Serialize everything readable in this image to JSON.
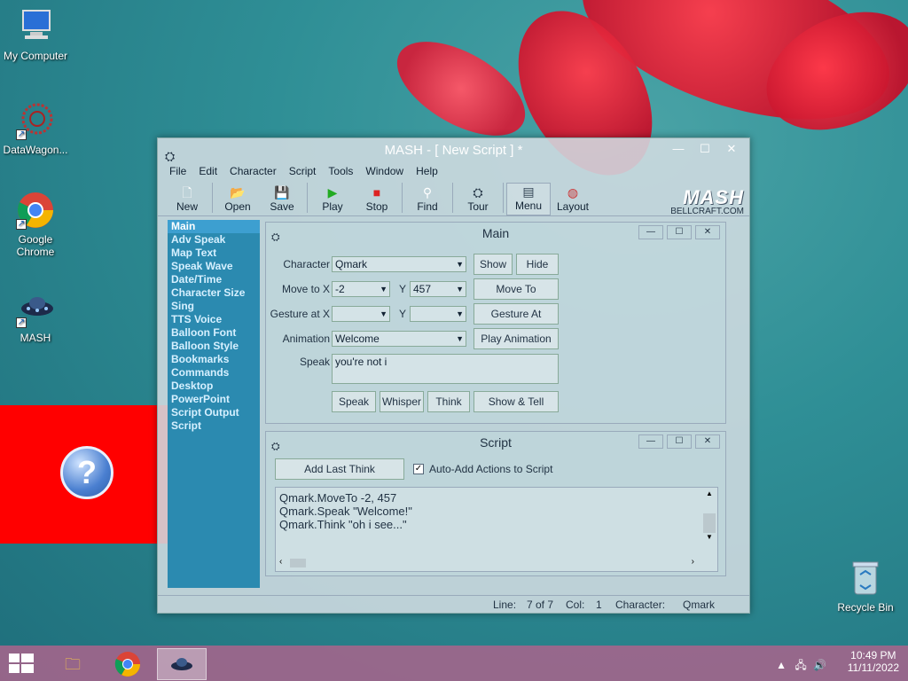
{
  "desktop": {
    "icons": [
      {
        "label": "My Computer",
        "icon": "computer-icon"
      },
      {
        "label": "DataWagon...",
        "icon": "datawagon-icon"
      },
      {
        "label": "Google Chrome",
        "icon": "chrome-icon"
      },
      {
        "label": "MASH",
        "icon": "mash-icon"
      }
    ],
    "recycle_bin": "Recycle Bin",
    "help_glyph": "?"
  },
  "window": {
    "title": "MASH - [ New Script ] *",
    "menu": [
      "File",
      "Edit",
      "Character",
      "Script",
      "Tools",
      "Window",
      "Help"
    ],
    "toolbar": [
      {
        "label": "New",
        "icon": "new-file-icon"
      },
      {
        "label": "Open",
        "icon": "open-folder-icon"
      },
      {
        "label": "Save",
        "icon": "save-disk-icon"
      },
      {
        "label": "Play",
        "icon": "play-icon"
      },
      {
        "label": "Stop",
        "icon": "stop-icon"
      },
      {
        "label": "Find",
        "icon": "find-icon"
      },
      {
        "label": "Tour",
        "icon": "tour-icon"
      },
      {
        "label": "Menu",
        "icon": "menu-icon"
      },
      {
        "label": "Layout",
        "icon": "layout-icon"
      }
    ],
    "brand": {
      "logo": "MASH",
      "sub": "BELLCRAFT.COM"
    }
  },
  "nav": {
    "items": [
      "Main",
      "Adv Speak",
      "Map Text",
      "Speak Wave",
      "Date/Time",
      "Character Size",
      "Sing",
      "TTS Voice",
      "Balloon Font",
      "Balloon Style",
      "Bookmarks",
      "Commands",
      "Desktop",
      "PowerPoint",
      "Script Output",
      "Script"
    ],
    "selected": "Main"
  },
  "main_panel": {
    "title": "Main",
    "character_label": "Character",
    "character_value": "Qmark",
    "show_label": "Show",
    "hide_label": "Hide",
    "move_to_label": "Move to X",
    "move_x": "-2",
    "y_label": "Y",
    "move_y": "457",
    "move_to_btn": "Move To",
    "gesture_label": "Gesture at X",
    "gesture_x": "",
    "gesture_y_label": "Y",
    "gesture_y": "",
    "gesture_btn": "Gesture At",
    "animation_label": "Animation",
    "animation_value": "Welcome",
    "play_animation_btn": "Play Animation",
    "speak_label": "Speak",
    "speak_value": "you're not i",
    "speak_btn": "Speak",
    "whisper_btn": "Whisper",
    "think_btn": "Think",
    "show_tell_btn": "Show & Tell"
  },
  "script_panel": {
    "title": "Script",
    "add_last_think_btn": "Add Last Think",
    "auto_add_label": "Auto-Add Actions to Script",
    "lines": [
      "Qmark.MoveTo -2, 457",
      "Qmark.Speak \"Welcome!\"",
      "Qmark.Think \"oh i see...\""
    ]
  },
  "status": {
    "line_label": "Line:",
    "line_value": "7 of 7",
    "col_label": "Col:",
    "col_value": "1",
    "character_label": "Character:",
    "character_value": "Qmark"
  },
  "taskbar": {
    "time": "10:49 PM",
    "date": "11/11/2022"
  }
}
